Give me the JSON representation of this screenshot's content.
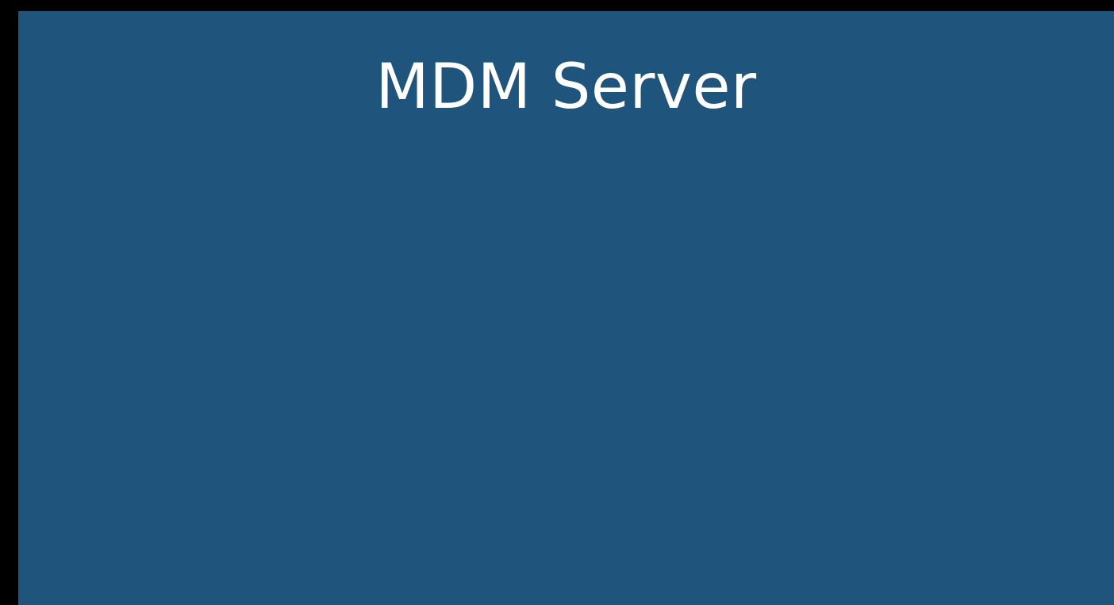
{
  "panel": {
    "title": "MDM Server"
  },
  "colors": {
    "background": "#000000",
    "panel": "#1f557c",
    "title_text": "#ffffff"
  }
}
